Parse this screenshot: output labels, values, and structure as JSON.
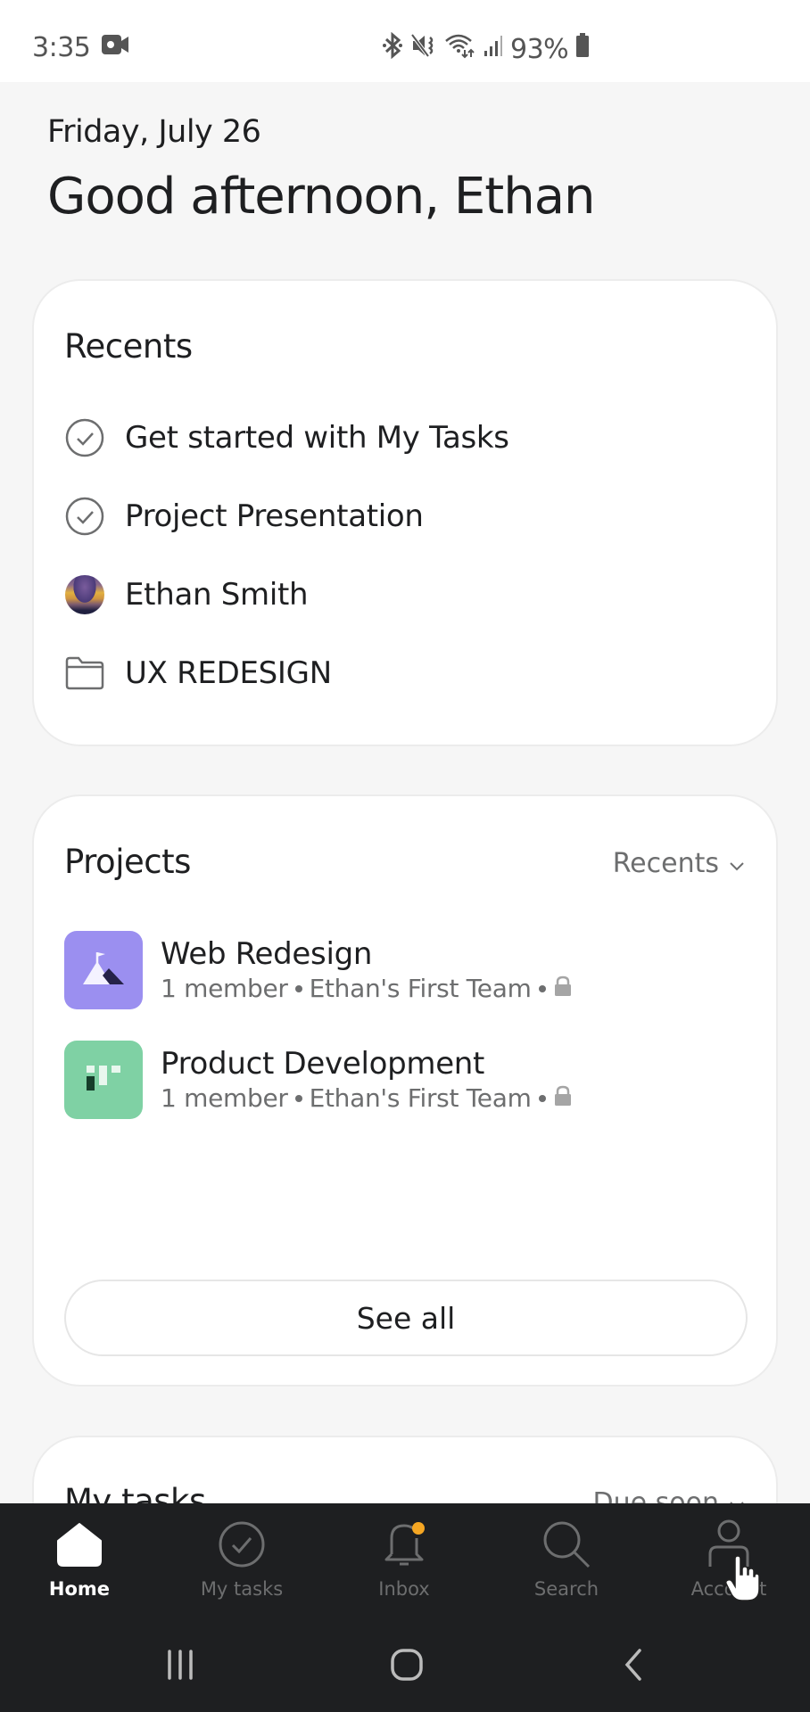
{
  "status_bar": {
    "time": "3:35",
    "battery_percent": "93%",
    "icons": [
      "video-record-icon",
      "bluetooth-icon",
      "mute-icon",
      "wifi-icon",
      "signal-icon",
      "battery-icon"
    ]
  },
  "header": {
    "date": "Friday, July 26",
    "greeting": "Good afternoon, Ethan"
  },
  "recents": {
    "title": "Recents",
    "items": [
      {
        "label": "Get started with My Tasks",
        "icon": "check-circle-icon"
      },
      {
        "label": "Project Presentation",
        "icon": "check-circle-icon"
      },
      {
        "label": "Ethan Smith",
        "icon": "avatar"
      },
      {
        "label": "UX REDESIGN",
        "icon": "folder-icon"
      }
    ]
  },
  "projects": {
    "title": "Projects",
    "sort_label": "Recents",
    "items": [
      {
        "name": "Web Redesign",
        "members": "1 member",
        "team": "Ethan's First Team",
        "color": "#9b8ff0",
        "icon": "mountain-flag-icon",
        "private": true
      },
      {
        "name": "Product Development",
        "members": "1 member",
        "team": "Ethan's First Team",
        "color": "#7fd1a4",
        "icon": "board-icon",
        "private": true
      }
    ],
    "see_all_label": "See all"
  },
  "my_tasks": {
    "title": "My tasks",
    "sort_label": "Due soon"
  },
  "bottom_nav": {
    "tabs": [
      {
        "label": "Home",
        "icon": "home-icon",
        "active": true
      },
      {
        "label": "My tasks",
        "icon": "check-circle-icon",
        "active": false
      },
      {
        "label": "Inbox",
        "icon": "bell-icon",
        "active": false,
        "badge_color": "#f5a623"
      },
      {
        "label": "Search",
        "icon": "search-icon",
        "active": false
      },
      {
        "label": "Account",
        "icon": "person-icon",
        "active": false
      }
    ]
  },
  "colors": {
    "background": "#f6f6f6",
    "card": "#ffffff",
    "nav_background": "#1e1f21",
    "text_primary": "#1e1f21",
    "text_secondary": "#6d6e6f",
    "notification": "#f5a623"
  }
}
